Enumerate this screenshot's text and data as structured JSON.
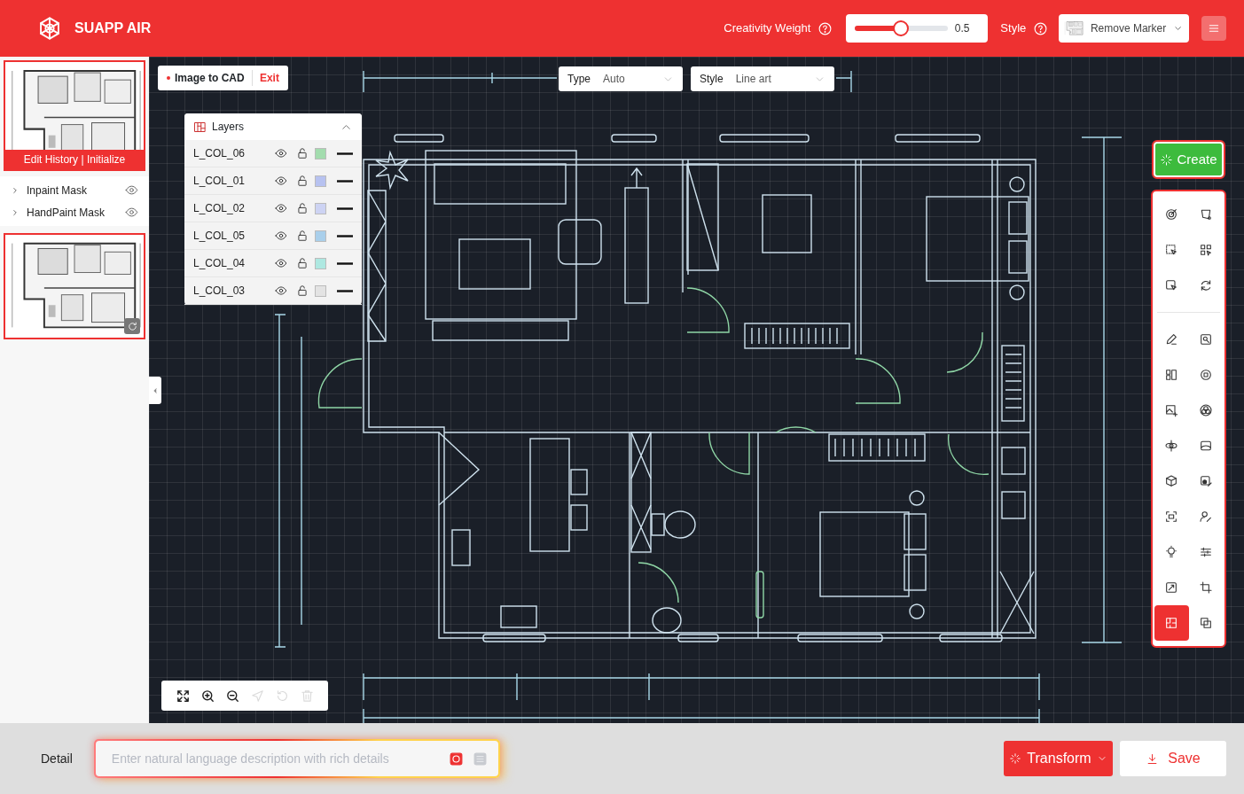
{
  "header": {
    "brand": "SUAPP AIR",
    "creativity_label": "Creativity Weight",
    "creativity": {
      "level": 0.5,
      "reading": "0.5"
    },
    "style_label": "Style",
    "style_select": {
      "value": "Remove Marker"
    }
  },
  "history": {
    "overlay": "Edit History | Initialize",
    "masks": [
      {
        "label": "Inpaint Mask"
      },
      {
        "label": "HandPaint Mask"
      }
    ]
  },
  "canvas": {
    "mode": "Image to CAD",
    "exit": "Exit",
    "type_select": {
      "label": "Type",
      "value": "Auto"
    },
    "style_select": {
      "label": "Style",
      "value": "Line art"
    },
    "layers": {
      "title": "Layers",
      "items": [
        {
          "name": "L_COL_06",
          "color": "#a3dcae"
        },
        {
          "name": "L_COL_01",
          "color": "#b7c2f0"
        },
        {
          "name": "L_COL_02",
          "color": "#cdd3f3"
        },
        {
          "name": "L_COL_05",
          "color": "#a9cfeb"
        },
        {
          "name": "L_COL_04",
          "color": "#aee8e1"
        },
        {
          "name": "L_COL_03",
          "color": "#e3e3e3"
        }
      ]
    },
    "zoom_tools": [
      {
        "disabled": false
      },
      {
        "disabled": false
      },
      {
        "disabled": false
      },
      {
        "disabled": true
      },
      {
        "disabled": true
      },
      {
        "disabled": true
      }
    ]
  },
  "toolbar": {
    "create": "Create",
    "tools": [
      {
        "selected": false
      },
      {
        "selected": false
      },
      {
        "selected": false
      },
      {
        "selected": false
      },
      {
        "selected": false
      },
      {
        "selected": false
      },
      {
        "selected": false
      },
      {
        "selected": false
      },
      {
        "selected": false
      },
      {
        "selected": false
      },
      {
        "selected": false
      },
      {
        "selected": false
      },
      {
        "selected": false
      },
      {
        "selected": false
      },
      {
        "selected": false
      },
      {
        "selected": false
      },
      {
        "selected": false
      },
      {
        "selected": false
      },
      {
        "selected": false
      },
      {
        "selected": false
      },
      {
        "selected": false
      },
      {
        "selected": false
      },
      {
        "selected": true
      },
      {
        "selected": false
      }
    ]
  },
  "footer": {
    "detail_label": "Detail",
    "prompt": {
      "placeholder": "Enter natural language description with rich details"
    },
    "transform": "Transform",
    "save": "Save"
  }
}
